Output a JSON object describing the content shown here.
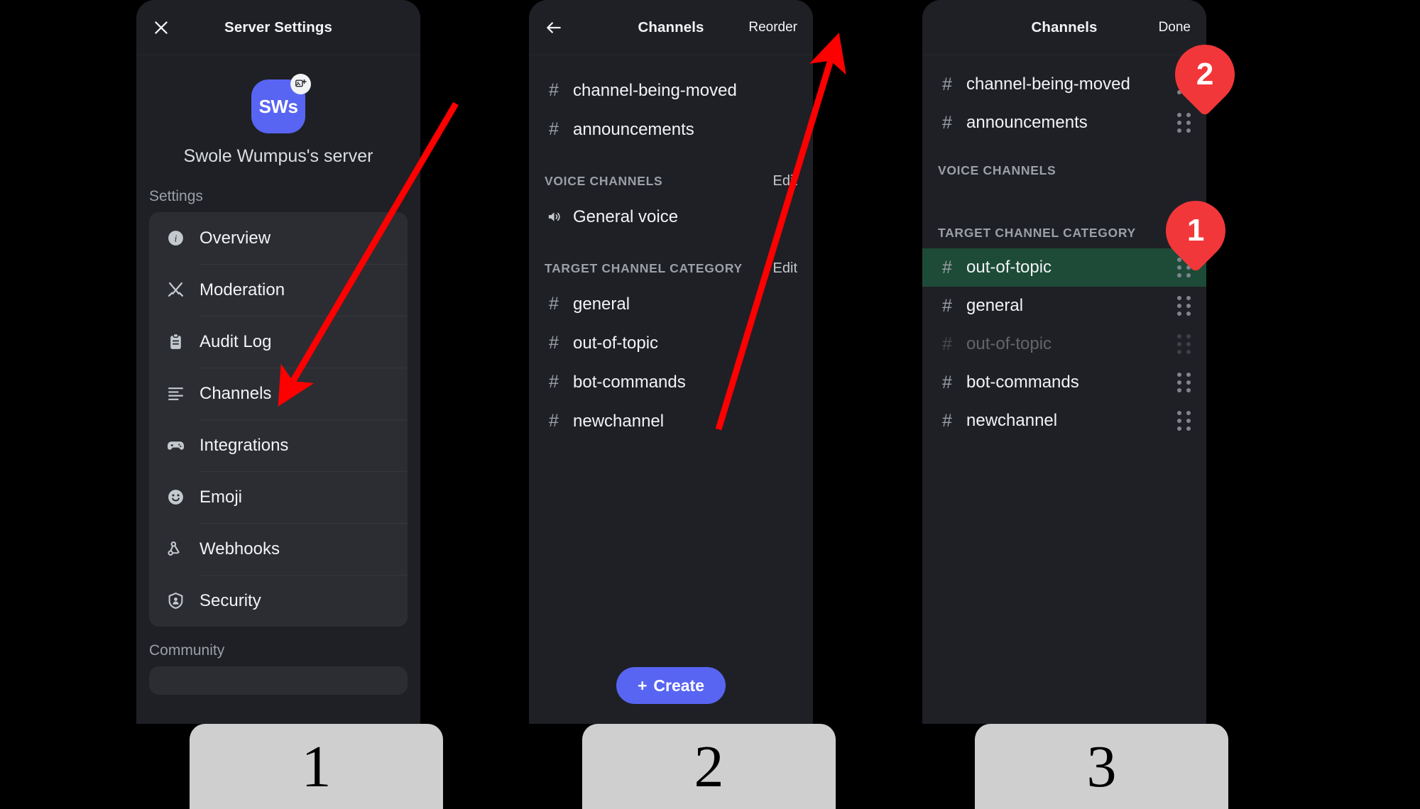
{
  "panel1": {
    "header": {
      "title": "Server Settings",
      "close_icon": "close-icon"
    },
    "server": {
      "avatar_initials": "SWs",
      "avatar_badge_icon": "add-image-icon",
      "name": "Swole Wumpus's server"
    },
    "section_label": "Settings",
    "menu": [
      {
        "label": "Overview",
        "icon": "info-icon"
      },
      {
        "label": "Moderation",
        "icon": "swords-icon"
      },
      {
        "label": "Audit Log",
        "icon": "clipboard-icon"
      },
      {
        "label": "Channels",
        "icon": "list-lines-icon"
      },
      {
        "label": "Integrations",
        "icon": "gamepad-icon"
      },
      {
        "label": "Emoji",
        "icon": "smiley-icon"
      },
      {
        "label": "Webhooks",
        "icon": "webhook-icon"
      },
      {
        "label": "Security",
        "icon": "shield-person-icon"
      }
    ],
    "community_label": "Community"
  },
  "panel2": {
    "header": {
      "title": "Channels",
      "back_icon": "back-arrow-icon",
      "action": "Reorder"
    },
    "text_channels": [
      {
        "name": "channel-being-moved"
      },
      {
        "name": "announcements"
      }
    ],
    "voice_category": {
      "title": "VOICE CHANNELS",
      "edit": "Edit"
    },
    "voice_channels": [
      {
        "name": "General voice",
        "icon": "speaker-icon"
      }
    ],
    "target_category": {
      "title": "TARGET CHANNEL CATEGORY",
      "edit": "Edit"
    },
    "target_channels": [
      {
        "name": "general"
      },
      {
        "name": "out-of-topic"
      },
      {
        "name": "bot-commands"
      },
      {
        "name": "newchannel"
      }
    ],
    "create_button": {
      "plus": "+",
      "label": "Create"
    }
  },
  "panel3": {
    "header": {
      "title": "Channels",
      "action": "Done"
    },
    "top_rows": [
      {
        "name": "channel-being-moved",
        "state": "normal"
      },
      {
        "name": "announcements",
        "state": "normal"
      }
    ],
    "voice_category_title": "VOICE CHANNELS",
    "target_category_title": "TARGET CHANNEL CATEGORY",
    "target_rows": [
      {
        "name": "out-of-topic",
        "state": "highlight"
      },
      {
        "name": "general",
        "state": "normal"
      },
      {
        "name": "out-of-topic",
        "state": "ghost"
      },
      {
        "name": "bot-commands",
        "state": "normal"
      },
      {
        "name": "newchannel",
        "state": "normal"
      }
    ],
    "drag_handle_icon": "drag-handle-icon"
  },
  "annotations": {
    "badges": [
      {
        "label": "1"
      },
      {
        "label": "2"
      }
    ],
    "arrow_color": "#ff0000",
    "arrow_1_name": "arrow-to-channels",
    "arrow_2_name": "arrow-to-reorder"
  },
  "steps": [
    {
      "number": "1"
    },
    {
      "number": "2"
    },
    {
      "number": "3"
    }
  ],
  "colors": {
    "brand": "#5865f2",
    "highlight_green": "#1d4b38",
    "annotation_red": "#f2373a",
    "panel_bg": "#1e2025"
  }
}
